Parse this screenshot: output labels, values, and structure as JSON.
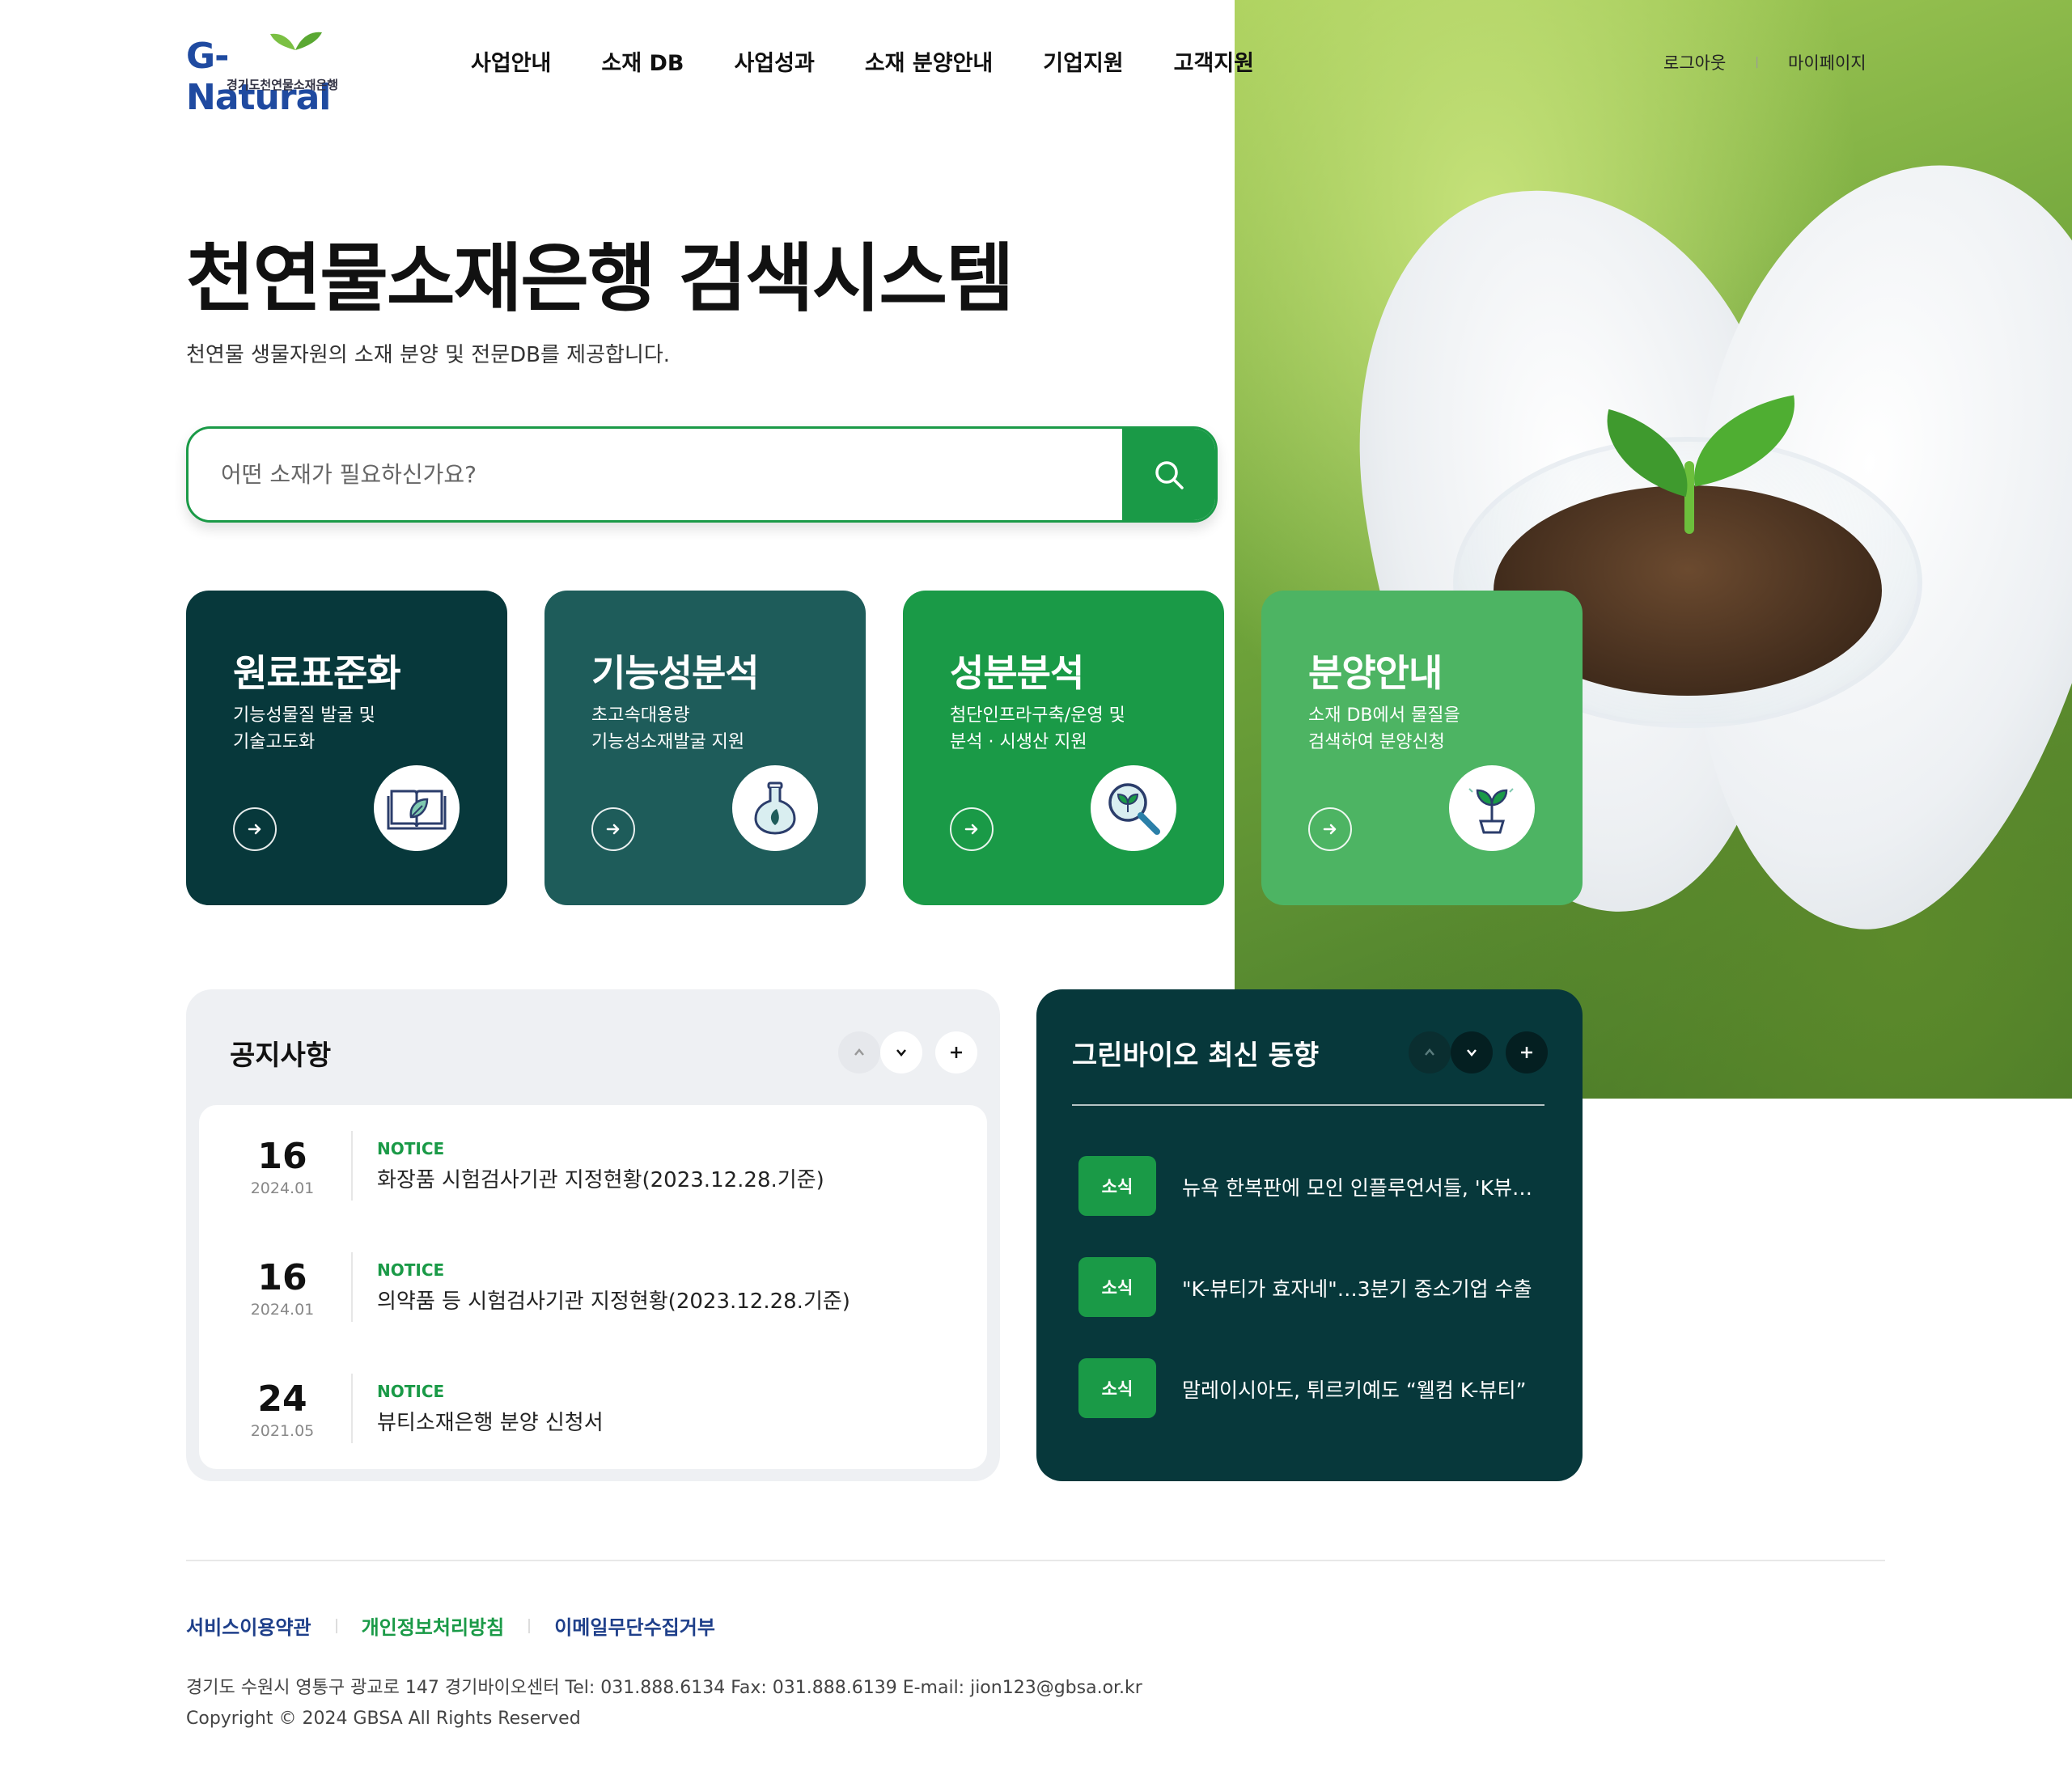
{
  "header": {
    "logo_text": "G-Natural",
    "logo_sub": "경기도천연물소재은행",
    "nav": [
      "사업안내",
      "소재 DB",
      "사업성과",
      "소재 분양안내",
      "기업지원",
      "고객지원"
    ],
    "util": [
      "로그아웃",
      "마이페이지"
    ]
  },
  "hero": {
    "title": "천연물소재은행 검색시스템",
    "subtitle": "천연물 생물자원의 소재 분양 및 전문DB를 제공합니다.",
    "search_placeholder": "어떤 소재가 필요하신가요?"
  },
  "cards": [
    {
      "title": "원료표준화",
      "desc": "기능성물질 발굴 및\n기술고도화",
      "color": "#07383b",
      "icon": "book-leaf-icon"
    },
    {
      "title": "기능성분석",
      "desc": "초고속대용량\n기능성소재발굴 지원",
      "color": "#1e5c5a",
      "icon": "flask-icon"
    },
    {
      "title": "성분분석",
      "desc": "첨단인프라구축/운영 및\n분석 · 시생산 지원",
      "color": "#1a9a47",
      "icon": "magnifier-sprout-icon"
    },
    {
      "title": "분양안내",
      "desc": "소재 DB에서 물질을\n검색하여 분양신청",
      "color": "#4db463",
      "icon": "sprout-pot-icon"
    }
  ],
  "notice": {
    "title": "공지사항",
    "items": [
      {
        "day": "16",
        "ym": "2024.01",
        "tag": "NOTICE",
        "title": "화장품 시험검사기관 지정현황(2023.12.28.기준)"
      },
      {
        "day": "16",
        "ym": "2024.01",
        "tag": "NOTICE",
        "title": "의약품 등 시험검사기관 지정현황(2023.12.28.기준)"
      },
      {
        "day": "24",
        "ym": "2021.05",
        "tag": "NOTICE",
        "title": "뷰티소재은행 분양 신청서"
      }
    ]
  },
  "news": {
    "title": "그린바이오 최신 동향",
    "items": [
      {
        "badge": "소식",
        "text": "뉴욕 한복판에 모인 인플루언서들, 'K뷰티' 열풍"
      },
      {
        "badge": "소식",
        "text": "\"K-뷰티가 효자네\"…3분기 중소기업 수출"
      },
      {
        "badge": "소식",
        "text": "말레이시아도, 튀르키예도 “웰컴 K-뷰티”"
      }
    ]
  },
  "footer": {
    "links": [
      "서비스이용약관",
      "개인정보처리방침",
      "이메일무단수집거부"
    ],
    "address": "경기도 수원시 영통구 광교로 147 경기바이오센터 Tel: 031.888.6134 Fax: 031.888.6139 E-mail: jion123@gbsa.or.kr",
    "copyright": "Copyright © 2024 GBSA All Rights Reserved"
  },
  "colors": {
    "brand_green": "#1a9a47",
    "dark_teal": "#07383b",
    "link_green": "#1a9a47"
  }
}
